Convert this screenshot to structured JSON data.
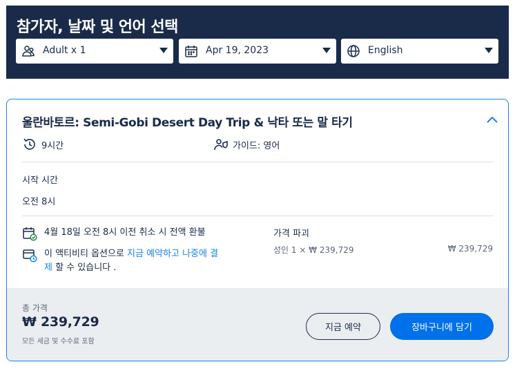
{
  "header": {
    "title": "참가자, 날짜 및 언어 선택",
    "participants": {
      "value": "Adult x 1",
      "icon": "participants-icon"
    },
    "date": {
      "value": "Apr 19, 2023",
      "icon": "calendar-icon"
    },
    "language": {
      "value": "English",
      "icon": "globe-icon"
    }
  },
  "activity": {
    "title": "울란바토르: Semi-Gobi Desert Day Trip & 낙타 또는 말 타기",
    "duration": "9시간",
    "guide": "가이드: 영어",
    "start_time_label": "시작 시간",
    "start_time_value": "오전 8시",
    "cancellation": "4월 18일 오전 8시 이전 취소 시 전액 환불",
    "pay_later_prefix": "이 액티비티 옵션으로 ",
    "pay_later_link": "지금 예약하고 나중에 결제",
    "pay_later_suffix": " 할 수 있습니다 .",
    "price_breakdown_title": "가격 파괴",
    "price_line_label": "성인 1 × ₩ 239,729",
    "price_line_value": "₩ 239,729"
  },
  "footer": {
    "total_label": "총 가격",
    "total_value": "₩ 239,729",
    "total_note": "모든 세금 및 수수료 포함",
    "book_now_label": "지금 예약",
    "add_to_cart_label": "장바구니에 담기"
  },
  "colors": {
    "header_bg": "#1a2b49",
    "accent": "#1583e9",
    "cart_button": "#0071eb",
    "footer_bg": "#ebeef1"
  }
}
